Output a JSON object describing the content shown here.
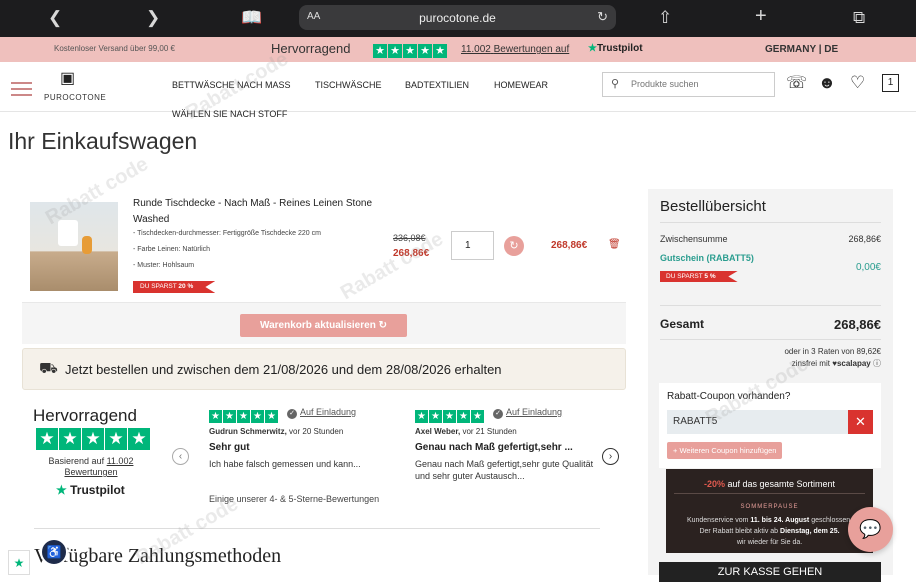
{
  "browser": {
    "text_size": "AA",
    "url": "purocotone.de"
  },
  "promo": {
    "shipping": "Kostenloser Versand über 99,00 €",
    "rating_word": "Hervorragend",
    "reviews_count": "11.002",
    "reviews_text": "Bewertungen auf",
    "trustpilot": "Trustpilot",
    "country": "GERMANY | DE"
  },
  "header": {
    "logo": "PUROCOTONE",
    "nav": [
      "BETTWÄSCHE NACH MASS",
      "TISCHWÄSCHE",
      "BADTEXTILIEN",
      "HOMEWEAR",
      "WÄHLEN SIE NACH STOFF"
    ],
    "search_placeholder": "Produkte suchen",
    "cart_count": "1"
  },
  "page_title": "Ihr Einkaufswagen",
  "cart_item": {
    "name": "Runde Tischdecke - Nach Maß - Reines Leinen Stone Washed",
    "specs": [
      "- Tischdecken-durchmesser: Fertiggröße Tischdecke 220 cm",
      "- Farbe Leinen: Natürlich",
      "- Muster: Hohlsaum"
    ],
    "save_label": "DU SPARST",
    "save_pct": "20 %",
    "old_price": "336,08€",
    "new_price": "268,86€",
    "quantity": "1",
    "line_total": "268,86€"
  },
  "update_button": "Warenkorb aktualisieren",
  "delivery_text": "Jetzt bestellen und zwischen dem 21/08/2026 und dem 28/08/2026 erhalten",
  "trustpilot_widget": {
    "rating_word": "Hervorragend",
    "based_on": "Basierend auf",
    "count": "11.002",
    "reviews_word": "Bewertungen",
    "logo": "Trustpilot",
    "footer": "Einige unserer 4- & 5-Sterne-Bewertungen",
    "reviews": [
      {
        "invite": "Auf Einladung",
        "author": "Gudrun Schmerwitz,",
        "time": "vor 20 Stunden",
        "headline": "Sehr gut",
        "body": "Ich habe falsch gemessen und kann..."
      },
      {
        "invite": "Auf Einladung",
        "author": "Axel Weber,",
        "time": "vor 21 Stunden",
        "headline": "Genau nach Maß gefertigt,sehr ...",
        "body": "Genau nach Maß gefertigt,sehr gute Qualität und sehr guter Austausch..."
      }
    ]
  },
  "payment_heading": "Verfügbare Zahlungsmethoden",
  "summary": {
    "title": "Bestellübersicht",
    "subtotal_label": "Zwischensumme",
    "subtotal": "268,86€",
    "coupon_label": "Gutschein (RABATT5)",
    "coupon_value": "0,00€",
    "save_label": "DU SPARST",
    "save_pct": "5 %",
    "total_label": "Gesamt",
    "total": "268,86€",
    "rates_line": "oder in 3 Raten von 89,62€",
    "rates_line2": "zinsfrei mit",
    "scalapay": "scalapay",
    "coupon_question": "Rabatt-Coupon vorhanden?",
    "coupon_code": "RABATT5",
    "add_coupon": "+ Weiteren Coupon hinzufügen",
    "banner_pct": "-20%",
    "banner_text": "auf das gesamte Sortiment",
    "banner_sub": "SOMMERPAUSE",
    "banner_body1": "Kundenservice vom",
    "banner_dates": "11. bis 24. August",
    "banner_body2": "geschlossen.",
    "banner_body3": "Der Rabatt bleibt aktiv ab",
    "banner_day": "Dienstag, dem 25.",
    "banner_body4": "wir wieder für Sie da.",
    "checkout": "ZUR KASSE GEHEN"
  },
  "colors": {
    "accent": "#e8a09b",
    "trustpilot": "#00b67a",
    "sale": "#d9332f",
    "promo_bg": "#efc0bd"
  },
  "watermark": "Rabatt code"
}
